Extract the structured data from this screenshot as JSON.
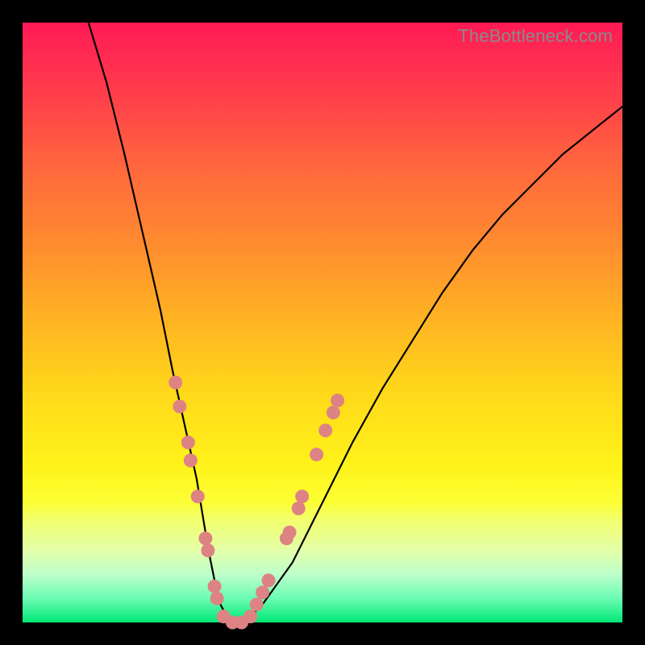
{
  "watermark": "TheBottleneck.com",
  "colors": {
    "dot": "#dd8383",
    "curve": "#000000",
    "frame": "#000000"
  },
  "chart_data": {
    "type": "line",
    "title": "",
    "xlabel": "",
    "ylabel": "",
    "xlim": [
      0,
      100
    ],
    "ylim": [
      0,
      100
    ],
    "grid": false,
    "legend": false,
    "annotations": [
      "TheBottleneck.com"
    ],
    "series": [
      {
        "name": "bottleneck-curve",
        "x": [
          11,
          14,
          17,
          20,
          23,
          25,
          27,
          29,
          30,
          31,
          32,
          33,
          34,
          35,
          37,
          40,
          45,
          50,
          55,
          60,
          65,
          70,
          75,
          80,
          85,
          90,
          95,
          100
        ],
        "y": [
          100,
          90,
          78,
          65,
          52,
          42,
          33,
          24,
          18,
          12,
          7,
          3,
          1,
          0,
          0,
          3,
          10,
          20,
          30,
          39,
          47,
          55,
          62,
          68,
          73,
          78,
          82,
          86
        ]
      }
    ],
    "markers": [
      {
        "x": 25.5,
        "y": 40
      },
      {
        "x": 26.2,
        "y": 36
      },
      {
        "x": 27.6,
        "y": 30
      },
      {
        "x": 28.0,
        "y": 27
      },
      {
        "x": 29.2,
        "y": 21
      },
      {
        "x": 30.5,
        "y": 14
      },
      {
        "x": 30.9,
        "y": 12
      },
      {
        "x": 32.0,
        "y": 6
      },
      {
        "x": 32.4,
        "y": 4
      },
      {
        "x": 33.5,
        "y": 1
      },
      {
        "x": 35.0,
        "y": 0
      },
      {
        "x": 36.5,
        "y": 0
      },
      {
        "x": 38.0,
        "y": 1
      },
      {
        "x": 39.0,
        "y": 3
      },
      {
        "x": 40.0,
        "y": 5
      },
      {
        "x": 41.0,
        "y": 7
      },
      {
        "x": 44.0,
        "y": 14
      },
      {
        "x": 44.5,
        "y": 15
      },
      {
        "x": 46.0,
        "y": 19
      },
      {
        "x": 46.6,
        "y": 21
      },
      {
        "x": 49.0,
        "y": 28
      },
      {
        "x": 50.5,
        "y": 32
      },
      {
        "x": 51.8,
        "y": 35
      },
      {
        "x": 52.5,
        "y": 37
      }
    ]
  }
}
